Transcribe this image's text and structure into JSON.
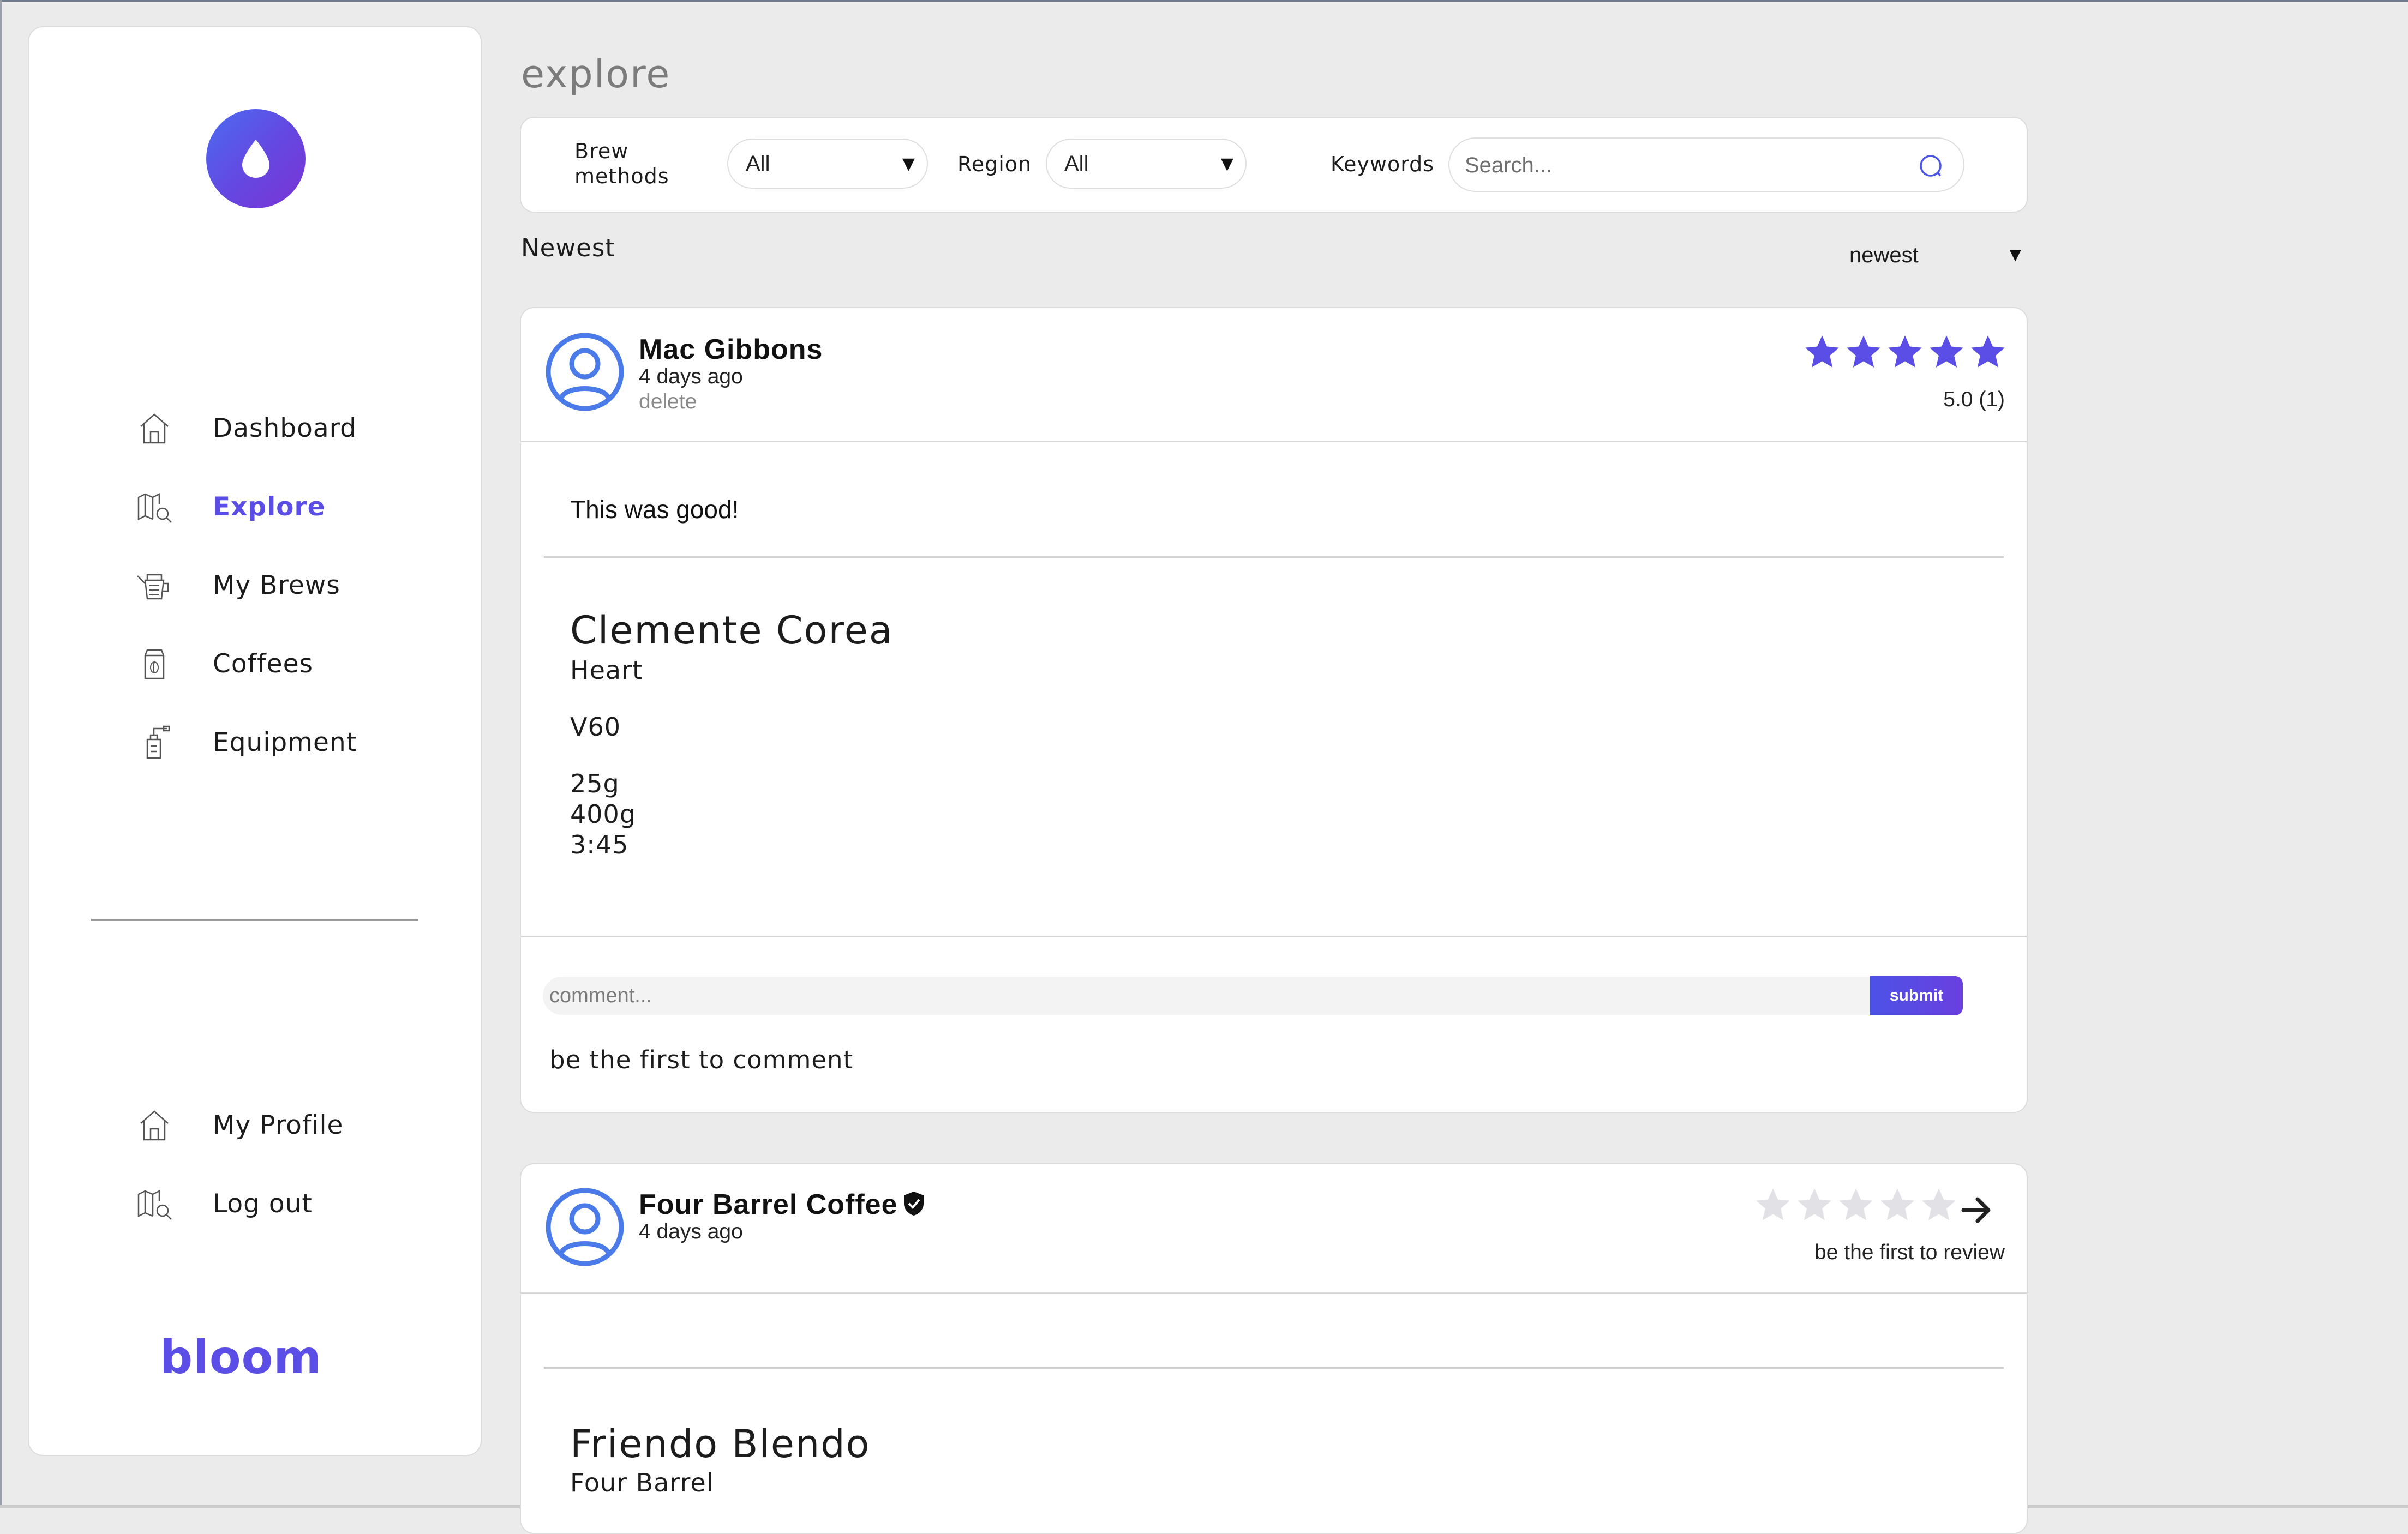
{
  "sidebar": {
    "nav": [
      {
        "label": "Dashboard",
        "icon": "house-icon"
      },
      {
        "label": "Explore",
        "icon": "map-search-icon",
        "active": true
      },
      {
        "label": "My Brews",
        "icon": "kettle-icon"
      },
      {
        "label": "Coffees",
        "icon": "coffee-bag-icon"
      },
      {
        "label": "Equipment",
        "icon": "grinder-icon"
      }
    ],
    "bottom": [
      {
        "label": "My Profile",
        "icon": "house-icon"
      },
      {
        "label": "Log out",
        "icon": "map-search-icon"
      }
    ],
    "brand": "bloom"
  },
  "page": {
    "title": "explore"
  },
  "filters": {
    "brew_methods_label": "Brew methods",
    "brew_methods_value": "All",
    "region_label": "Region",
    "region_value": "All",
    "keywords_label": "Keywords",
    "search_placeholder": "Search..."
  },
  "list": {
    "section_label": "Newest",
    "sort_value": "newest"
  },
  "posts": [
    {
      "author": "Mac Gibbons",
      "time": "4 days ago",
      "delete_label": "delete",
      "rating": 5,
      "rating_text": "5.0 (1)",
      "review": "This was good!",
      "coffee": "Clemente Corea",
      "roaster": "Heart",
      "method": "V60",
      "dose": "25g",
      "water": "400g",
      "brew_time": "3:45",
      "comment_placeholder": "comment...",
      "submit_label": "submit",
      "no_comments": "be the first to comment"
    },
    {
      "author": "Four Barrel Coffee",
      "verified": true,
      "time": "4 days ago",
      "rating": 0,
      "rating_text": "be the first to review",
      "coffee": "Friendo Blendo",
      "roaster": "Four Barrel"
    }
  ],
  "colors": {
    "accent": "#5b4ee6",
    "avatar": "#4a7be8",
    "star_empty": "#e2e2e6",
    "background": "#ebebeb"
  }
}
